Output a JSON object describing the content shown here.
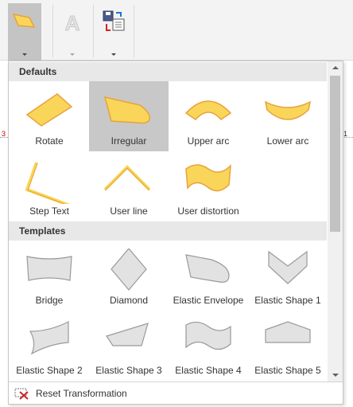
{
  "panel": {
    "sections": [
      {
        "title": "Defaults",
        "items": [
          {
            "label": "Rotate",
            "icon": "rotate-shape-icon",
            "selected": false
          },
          {
            "label": "Irregular",
            "icon": "irregular-shape-icon",
            "selected": true
          },
          {
            "label": "Upper arc",
            "icon": "upper-arc-shape-icon",
            "selected": false
          },
          {
            "label": "Lower arc",
            "icon": "lower-arc-shape-icon",
            "selected": false
          },
          {
            "label": "Step Text",
            "icon": "step-text-shape-icon",
            "selected": false
          },
          {
            "label": "User line",
            "icon": "user-line-shape-icon",
            "selected": false
          },
          {
            "label": "User distortion",
            "icon": "user-distortion-shape-icon",
            "selected": false
          }
        ]
      },
      {
        "title": "Templates",
        "items": [
          {
            "label": "Bridge",
            "icon": "bridge-shape-icon"
          },
          {
            "label": "Diamond",
            "icon": "diamond-shape-icon"
          },
          {
            "label": "Elastic Envelope",
            "icon": "elastic-envelope-shape-icon"
          },
          {
            "label": "Elastic Shape 1",
            "icon": "elastic-shape-1-icon"
          },
          {
            "label": "Elastic Shape 2",
            "icon": "elastic-shape-2-icon"
          },
          {
            "label": "Elastic Shape 3",
            "icon": "elastic-shape-3-icon"
          },
          {
            "label": "Elastic Shape 4",
            "icon": "elastic-shape-4-icon"
          },
          {
            "label": "Elastic Shape 5",
            "icon": "elastic-shape-5-icon"
          }
        ]
      }
    ],
    "footer": {
      "label": "Reset Transformation",
      "icon": "reset-transformation-icon"
    }
  },
  "ribbon": {
    "buttons": [
      {
        "icon": "transform-shape-icon",
        "active": true
      },
      {
        "icon": "text-effect-icon",
        "active": false,
        "disabled": true
      },
      {
        "icon": "save-load-icon",
        "active": false
      }
    ]
  },
  "background": {
    "left_mark": "3",
    "right_mark": "1"
  },
  "colors": {
    "shape_fill": "#f9d65a",
    "shape_stroke": "#e8a23c",
    "template_fill": "#e2e2e2",
    "template_stroke": "#9a9a9a",
    "selected_bg": "#c8c8c8"
  }
}
